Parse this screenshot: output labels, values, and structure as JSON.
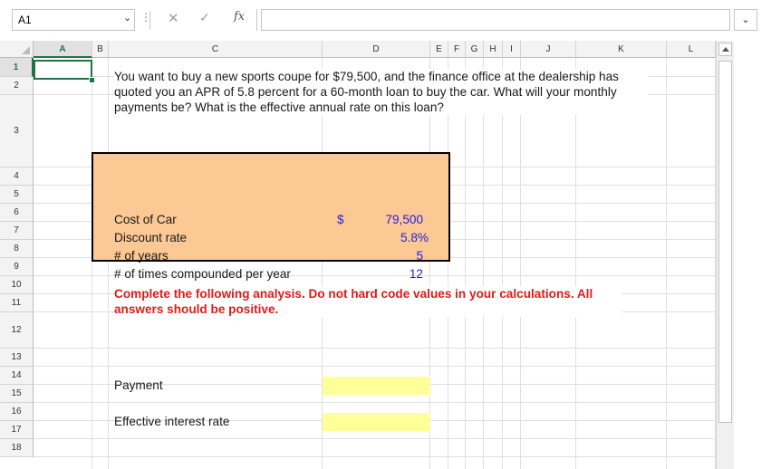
{
  "formula_bar": {
    "name_box": "A1",
    "fx_label": "fx",
    "formula": ""
  },
  "columns": [
    "A",
    "B",
    "C",
    "D",
    "E",
    "F",
    "G",
    "H",
    "I",
    "J",
    "K",
    "L"
  ],
  "rows": [
    "1",
    "2",
    "3",
    "4",
    "5",
    "6",
    "7",
    "8",
    "9",
    "10",
    "11",
    "12",
    "13",
    "14",
    "15",
    "16",
    "17",
    "18"
  ],
  "question": "You want to buy a new sports coupe for $79,500, and the finance office at the dealership has quoted you an APR of 5.8 percent for a 60-month loan to buy the car. What will your monthly payments be? What is the effective annual rate on this loan?",
  "inputs": {
    "cost_label": "Cost of Car",
    "cost_currency": "$",
    "cost_value": "79,500",
    "rate_label": "Discount rate",
    "rate_value": "5.8%",
    "years_label": "# of years",
    "years_value": "5",
    "compound_label": "# of times compounded per year",
    "compound_value": "12"
  },
  "instruction": "Complete the following analysis. Do not hard code values in your calculations. All answers should be positive.",
  "outputs": {
    "payment_label": "Payment",
    "effective_label": "Effective interest rate"
  },
  "colors": {
    "input_fill": "#fcc894",
    "answer_fill": "#ffff99",
    "instruction_text": "#e01b1b",
    "input_value_text": "#2323d8",
    "selection": "#217346"
  }
}
